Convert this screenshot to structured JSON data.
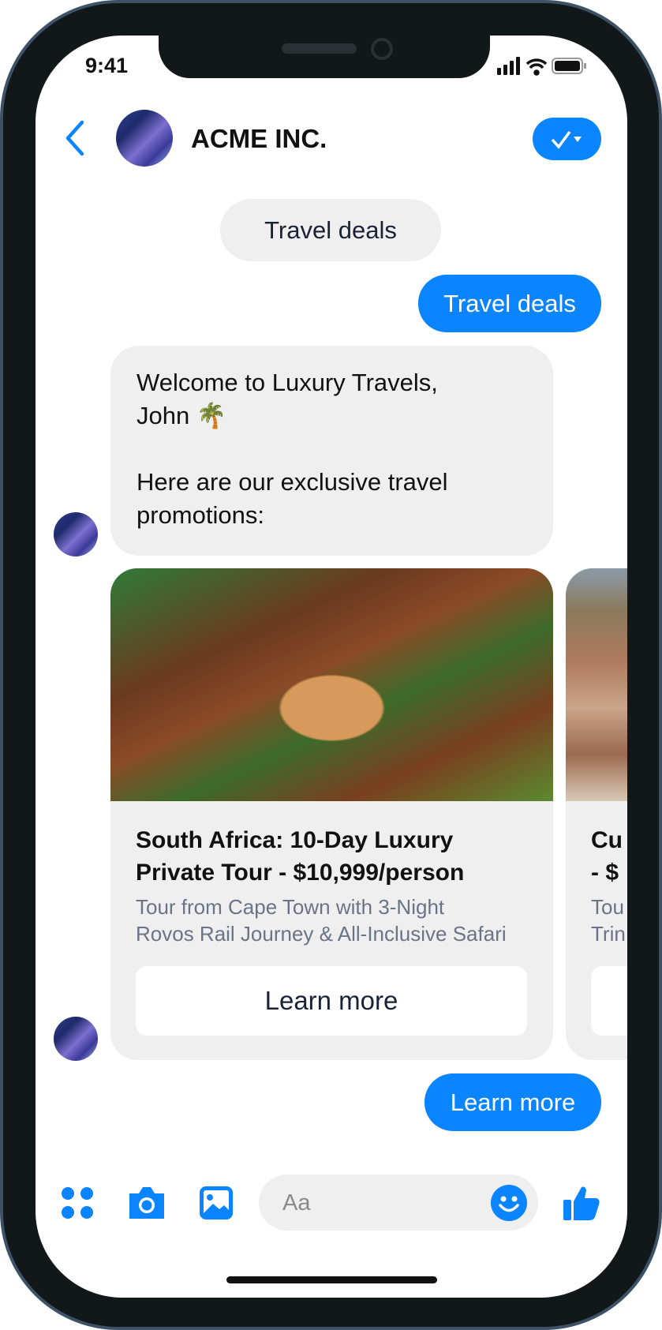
{
  "status": {
    "time": "9:41"
  },
  "header": {
    "title": "ACME INC."
  },
  "messages": {
    "quick_reply_chip": "Travel deals",
    "user_1": "Travel deals",
    "bot_line1": "Welcome to Luxury Travels,",
    "bot_line2": "John 🌴",
    "bot_line3": "Here are our exclusive travel",
    "bot_line4": "promotions:",
    "user_2": "Learn more"
  },
  "cards": [
    {
      "title_line1": "South Africa: 10-Day Luxury",
      "title_line2": "Private Tour - $10,999/person",
      "desc_line1": "Tour from Cape Town with 3-Night",
      "desc_line2": "Rovos Rail Journey & All-Inclusive Safari",
      "button": "Learn more"
    },
    {
      "title_line1": "Cu",
      "title_line2": "- $",
      "desc_line1": "Tou",
      "desc_line2": "Trin"
    }
  ],
  "composer": {
    "placeholder": "Aa"
  },
  "colors": {
    "accent": "#0a84ff",
    "bubble_gray": "#efefef"
  }
}
